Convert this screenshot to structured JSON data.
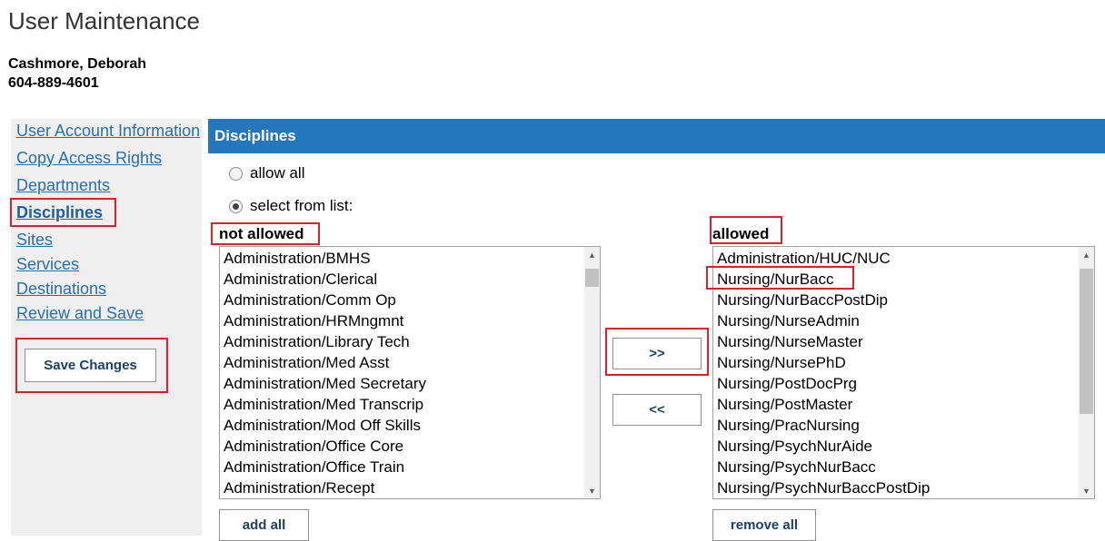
{
  "header": {
    "title": "User Maintenance",
    "user_name": "Cashmore, Deborah",
    "user_phone": "604-889-4601"
  },
  "sidebar": {
    "items": [
      {
        "label": "User Account Information"
      },
      {
        "label": "Copy Access Rights"
      },
      {
        "label": "Departments"
      },
      {
        "label": "Disciplines"
      },
      {
        "label": "Sites"
      },
      {
        "label": "Services"
      },
      {
        "label": "Destinations"
      },
      {
        "label": "Review and Save"
      }
    ],
    "active_item": "Disciplines",
    "save_label": "Save Changes"
  },
  "panel": {
    "title": "Disciplines",
    "radio_allow_all": "allow all",
    "radio_select": "select from list:",
    "selected_option": "select from list:",
    "not_allowed_label": "not allowed",
    "allowed_label": "allowed",
    "not_allowed_items": [
      "Administration/BMHS",
      "Administration/Clerical",
      "Administration/Comm Op",
      "Administration/HRMngmnt",
      "Administration/Library Tech",
      "Administration/Med Asst",
      "Administration/Med Secretary",
      "Administration/Med Transcrip",
      "Administration/Mod Off Skills",
      "Administration/Office Core",
      "Administration/Office Train",
      "Administration/Recept"
    ],
    "allowed_items": [
      "Administration/HUC/NUC",
      "Nursing/NurBacc",
      "Nursing/NurBaccPostDip",
      "Nursing/NurseAdmin",
      "Nursing/NurseMaster",
      "Nursing/NursePhD",
      "Nursing/PostDocPrg",
      "Nursing/PostMaster",
      "Nursing/PracNursing",
      "Nursing/PsychNurAide",
      "Nursing/PsychNurBacc",
      "Nursing/PsychNurBaccPostDip"
    ],
    "move_right_label": ">>",
    "move_left_label": "<<",
    "add_all_label": "add all",
    "remove_all_label": "remove all"
  },
  "icons": {
    "scroll_up": "▲",
    "scroll_down": "▼"
  },
  "colors": {
    "header_bar": "#2577bd",
    "link": "#2a6eb5",
    "highlight": "#d9202b"
  }
}
